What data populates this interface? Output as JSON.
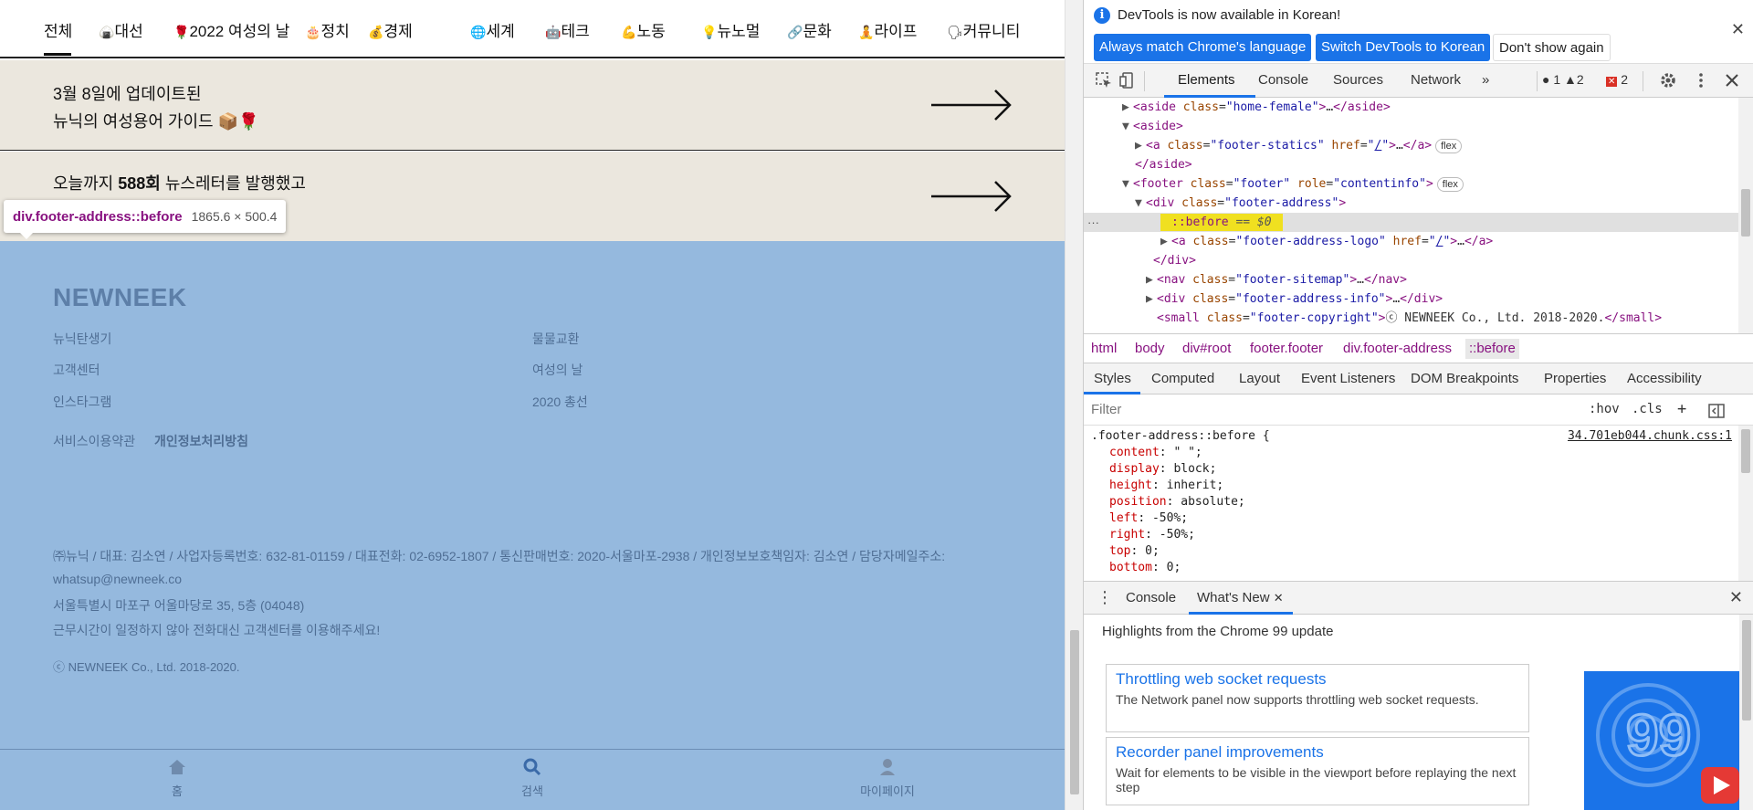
{
  "nav": {
    "tabs": [
      {
        "label": "전체",
        "icon": ""
      },
      {
        "label": "대선",
        "icon": "🍙"
      },
      {
        "label": "2022 여성의 날",
        "icon": "🌹"
      },
      {
        "label": "정치",
        "icon": "🎂"
      },
      {
        "label": "경제",
        "icon": "💰"
      },
      {
        "label": "세계",
        "icon": "🌐"
      },
      {
        "label": "테크",
        "icon": "🤖"
      },
      {
        "label": "노동",
        "icon": "💪"
      },
      {
        "label": "뉴노멀",
        "icon": "💡"
      },
      {
        "label": "문화",
        "icon": "🔗"
      },
      {
        "label": "라이프",
        "icon": "🧘"
      },
      {
        "label": "커뮤니티",
        "icon": "🗣"
      }
    ]
  },
  "banners": [
    {
      "line1": "3월 8일에 업데이트된",
      "line2": "뉴닉의 여성용어 가이드 📦🌹"
    },
    {
      "line1_pre": "오늘까지 ",
      "line1_bold": "588회",
      "line1_post": " 뉴스레터를 발행했고"
    }
  ],
  "inspect_label": {
    "selector": "div.footer-address::before",
    "size": "1865.6 × 500.4"
  },
  "footer": {
    "logo": "NEWNEEK",
    "links_left": [
      "뉴닉탄생기",
      "고객센터",
      "인스타그램"
    ],
    "links_right": [
      "물물교환",
      "여성의 날",
      "2020 총선"
    ],
    "terms": "서비스이용약관",
    "privacy": "개인정보처리방침",
    "info_line1": "㈜뉴닉 / 대표: 김소연 / 사업자등록번호: 632-81-01159 / 대표전화: 02-6952-1807 / 통신판매번호: 2020-서울마포-2938 / 개인정보보호책임자: 김소연 / 담당자메일주소:",
    "info_line2": "whatsup@newneek.co",
    "address": "서울특별시 마포구 어울마당로 35, 5층 (04048)",
    "notice": "근무시간이 일정하지 않아 전화대신 고객센터를 이용해주세요!",
    "copyright": "ⓒ NEWNEEK Co., Ltd. 2018-2020.",
    "bottom_nav": [
      {
        "label": "홈",
        "icon": "home-icon"
      },
      {
        "label": "검색",
        "icon": "search-icon"
      },
      {
        "label": "마이페이지",
        "icon": "user-icon"
      }
    ]
  },
  "devtools": {
    "info_message": "DevTools is now available in Korean!",
    "btn_match": "Always match Chrome's language",
    "btn_switch": "Switch DevTools to Korean",
    "btn_dont": "Don't show again",
    "tabs": [
      "Elements",
      "Console",
      "Sources",
      "Network"
    ],
    "more": "»",
    "badges": {
      "info": "1",
      "warn": "2",
      "err": "2"
    },
    "dom": {
      "r1_class": "home-female",
      "r3_class": "footer-statics",
      "r3_href": "/",
      "flex": "flex",
      "r5_class": "footer",
      "r5_role": "contentinfo",
      "r6_class": "footer-address",
      "r7_pseudo": "::before",
      "r7_eq": "== $0",
      "r8_class": "footer-address-logo",
      "r8_href": "/",
      "r10_class": "footer-sitemap",
      "r11_class": "footer-address-info",
      "r12_class": "footer-copyright",
      "r12_text": "ⓒ NEWNEEK Co., Ltd. 2018-2020."
    },
    "breadcrumbs": [
      "html",
      "body",
      "div#root",
      "footer.footer",
      "div.footer-address",
      "::before"
    ],
    "style_tabs": [
      "Styles",
      "Computed",
      "Layout",
      "Event Listeners",
      "DOM Breakpoints",
      "Properties",
      "Accessibility"
    ],
    "filter_placeholder": "Filter",
    "filter_opts": [
      ":hov",
      ".cls",
      "+"
    ],
    "rule_selector": ".footer-address::before {",
    "rule_source": "34.701eb044.chunk.css:1",
    "declarations": [
      {
        "prop": "content",
        "val": "\" \";"
      },
      {
        "prop": "display",
        "val": "block;"
      },
      {
        "prop": "height",
        "val": "inherit;"
      },
      {
        "prop": "position",
        "val": "absolute;"
      },
      {
        "prop": "left",
        "val": "-50%;"
      },
      {
        "prop": "right",
        "val": "-50%;"
      },
      {
        "prop": "top",
        "val": "0;"
      },
      {
        "prop": "bottom",
        "val": "0;"
      }
    ],
    "drawer_tabs": [
      "Console",
      "What's New"
    ],
    "highlights": "Highlights from the Chrome 99 update",
    "cards": [
      {
        "title": "Throttling web socket requests",
        "desc": "The Network panel now supports throttling web socket requests."
      },
      {
        "title": "Recorder panel improvements",
        "desc": "Wait for elements to be visible in the viewport before replaying the next step"
      }
    ]
  }
}
